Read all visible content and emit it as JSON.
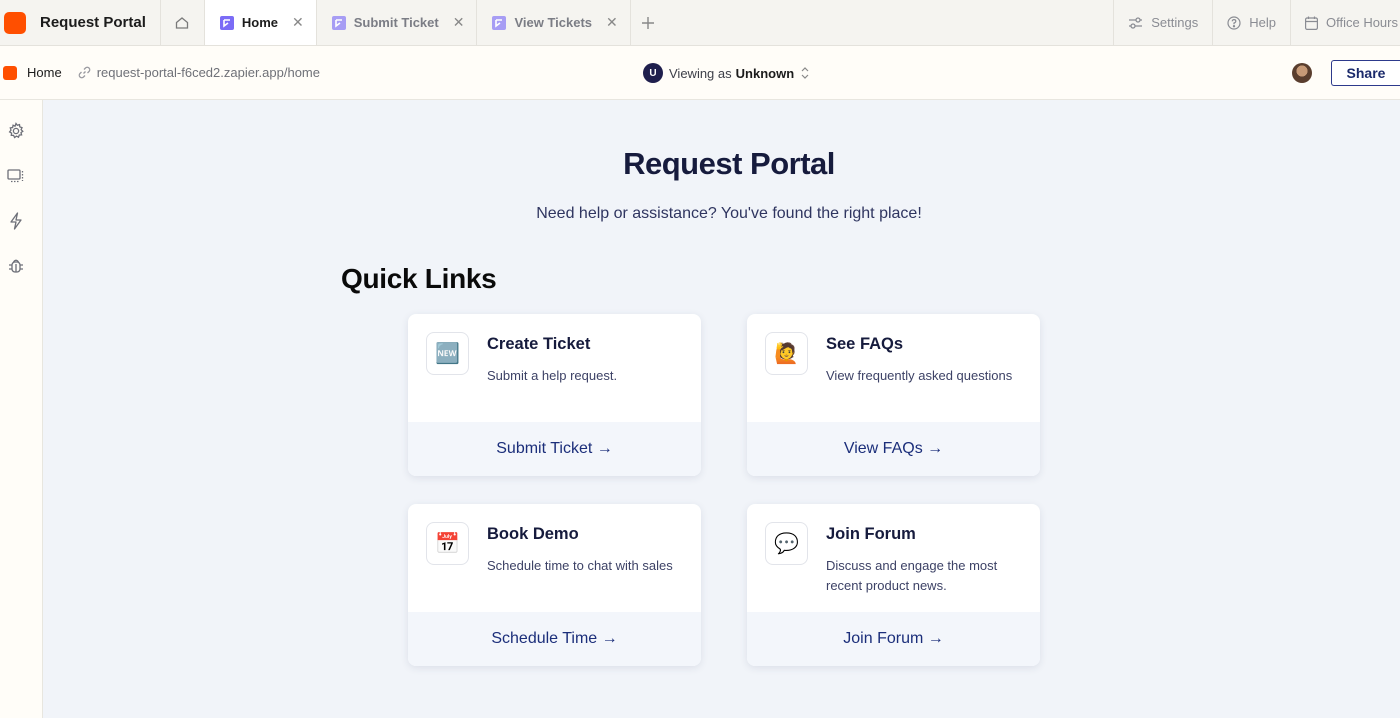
{
  "app": {
    "title": "Request Portal"
  },
  "tabs": [
    {
      "label": "Home",
      "active": true
    },
    {
      "label": "Submit Ticket",
      "active": false
    },
    {
      "label": "View Tickets",
      "active": false
    }
  ],
  "top_right": {
    "settings": "Settings",
    "help": "Help",
    "office_hours": "Office Hours"
  },
  "address": {
    "home_label": "Home",
    "url": "request-portal-f6ced2.zapier.app/home",
    "viewing_avatar": "U",
    "viewing_prefix": "Viewing as",
    "viewing_user": "Unknown",
    "share_label": "Share"
  },
  "main": {
    "title": "Request Portal",
    "subtitle": "Need help or assistance? You've found the right place!",
    "quick_links_title": "Quick Links",
    "cards": [
      {
        "icon": "new-button-emoji-icon",
        "emoji": "🆕",
        "heading": "Create Ticket",
        "description": "Submit a help request.",
        "link": "Submit Ticket →"
      },
      {
        "icon": "person-raising-hand-emoji-icon",
        "emoji": "🙋",
        "heading": "See FAQs",
        "description": "View frequently asked questions",
        "link": "View FAQs →"
      },
      {
        "icon": "calendar-emoji-icon",
        "emoji": "📅",
        "heading": "Book Demo",
        "description": "Schedule time to chat with sales",
        "link": "Schedule Time →"
      },
      {
        "icon": "speech-balloon-emoji-icon",
        "emoji": "💬",
        "heading": "Join Forum",
        "description": "Discuss and engage the most recent product news.",
        "link": "Join Forum →"
      }
    ]
  },
  "colors": {
    "brand": "#ff4f00",
    "accent": "#1b2e7a",
    "tab_icon": "#7b6cf6"
  }
}
